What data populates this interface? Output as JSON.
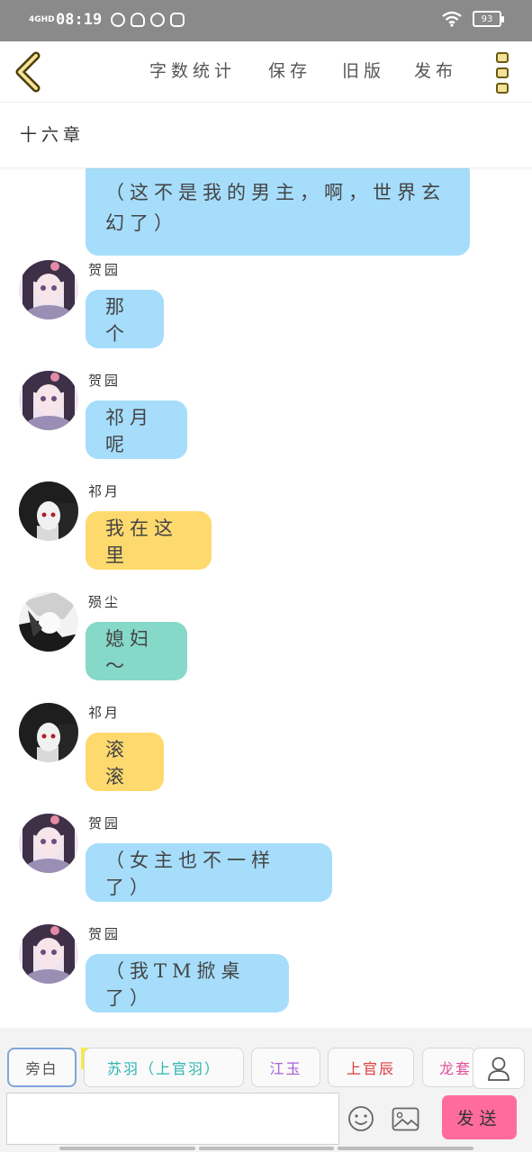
{
  "status_bar": {
    "network": "4GHD",
    "time": "08:19",
    "battery": "93"
  },
  "toolbar": {
    "word_count_label": "字数统计",
    "save_label": "保存",
    "old_version_label": "旧版",
    "publish_label": "发布"
  },
  "chapter": {
    "title": "十六章"
  },
  "messages": [
    {
      "sender": "",
      "text": "（这不是我的男主，啊，世界玄幻了）",
      "line1": "（这不是我的男主，啊，世界玄",
      "line2": "幻了）",
      "color": "blue"
    },
    {
      "sender": "贺园",
      "text": "那个",
      "color": "blue"
    },
    {
      "sender": "贺园",
      "text": "祁月呢",
      "color": "blue"
    },
    {
      "sender": "祁月",
      "text": "我在这里",
      "color": "yellow"
    },
    {
      "sender": "殒尘",
      "text": "媳妇～",
      "color": "teal"
    },
    {
      "sender": "祁月",
      "text": "滚滚",
      "color": "yellow"
    },
    {
      "sender": "贺园",
      "text": "（女主也不一样了）",
      "color": "blue"
    },
    {
      "sender": "贺园",
      "text": "（我TM掀桌了）",
      "color": "blue"
    }
  ],
  "bottom": {
    "roles": [
      {
        "label": "旁白",
        "color": "#555555"
      },
      {
        "label": "苏羽（上官羽）",
        "color": "#2bb5b0"
      },
      {
        "label": "江玉",
        "color": "#a45fd4"
      },
      {
        "label": "上官辰",
        "color": "#e03b3b"
      },
      {
        "label": "龙套",
        "color": "#e0529b"
      }
    ],
    "main_badge": "主",
    "input_value": "",
    "send_label": "发送"
  },
  "colors": {
    "bubble_blue": "#a6ddfb",
    "bubble_yellow": "#fdd96e",
    "bubble_teal": "#86d8c9",
    "send_button": "#ff6b9d"
  }
}
